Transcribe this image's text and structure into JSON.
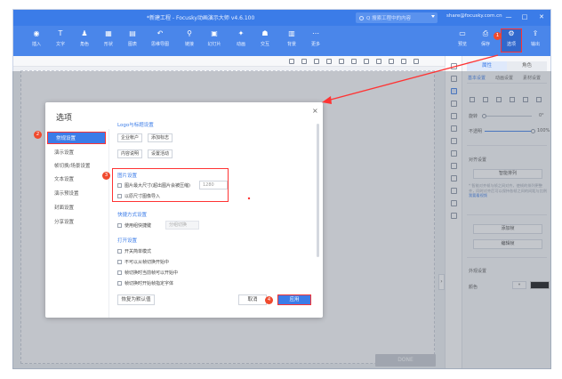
{
  "window": {
    "title": "*新建工程 - Focusky动画演示大师  v4.6.100",
    "search_placeholder": "Q  搜索工程中的内容",
    "user": "share@focusky.com.cn",
    "controls": [
      "—",
      "□",
      "✕"
    ]
  },
  "toolbar": {
    "left_tools": [
      {
        "icon": "◉",
        "label": "插入"
      },
      {
        "icon": "T",
        "label": "文字"
      },
      {
        "icon": "♟",
        "label": "角色"
      },
      {
        "icon": "▦",
        "label": "形状"
      },
      {
        "icon": "▤",
        "label": "图表"
      },
      {
        "icon": "↶",
        "label": "思维导图"
      },
      {
        "icon": "⚲",
        "label": "链接"
      },
      {
        "icon": "▣",
        "label": "幻灯片"
      },
      {
        "icon": "✦",
        "label": "动画"
      },
      {
        "icon": "☗",
        "label": "交互"
      },
      {
        "icon": "▥",
        "label": "背景"
      },
      {
        "icon": "⋯",
        "label": "更多"
      }
    ],
    "right_tools": [
      {
        "icon": "▭",
        "label": "预览"
      },
      {
        "icon": "⎙",
        "label": "保存"
      },
      {
        "icon": "⚙",
        "label": "选项"
      },
      {
        "icon": "⇪",
        "label": "输出"
      }
    ],
    "options_badge": "1"
  },
  "workspace": {
    "done_button": "DONE",
    "expand_handle": "›"
  },
  "panel": {
    "tabs": [
      "属性",
      "角色"
    ],
    "subtabs": [
      "基本设置",
      "动画设置",
      "素材设置"
    ],
    "angle_label": "旋转",
    "angle_value": "0°",
    "opacity_label": "不透明",
    "opacity_value": "100%",
    "layout_section": "对齐设置",
    "smart_align_button": "智能排列",
    "note_text": "* 智能对齐帧与帧之间对齐，使帧的排列更整齐，同时对齐后可以保持各帧之间的间距与比例",
    "note_link": "我要看视频",
    "add_frame_button": "添加帧",
    "edit_frame_button": "编辑帧",
    "appearance_section": "外观设置",
    "color_label": "颜色",
    "color_select": "▾",
    "color_value": "#111111"
  },
  "dialog": {
    "title": "选项",
    "close": "×",
    "badge_side": "2",
    "badge_section": "3",
    "badge_apply": "4",
    "sidebar": [
      {
        "label": "常规设置",
        "active": true
      },
      {
        "label": "演示设置",
        "active": false
      },
      {
        "label": "帧切换/场景设置",
        "active": false
      },
      {
        "label": "文本设置",
        "active": false
      },
      {
        "label": "演示预设置",
        "active": false
      },
      {
        "label": "封面设置",
        "active": false
      },
      {
        "label": "分享设置",
        "active": false
      }
    ],
    "logo_section": {
      "title": "Logo与标题设置",
      "buttons": [
        "企业帐户",
        "添加标志",
        "内容说明",
        "设置活动"
      ]
    },
    "image_section": {
      "title": "图片设置",
      "option1": "图片最大尺寸(超出图片会被压缩)",
      "option1_value": "1280",
      "option2": "以原尺寸图像导入"
    },
    "hotkey_section": {
      "title": "快捷方式设置",
      "option": "使用组快捷键",
      "input_value": "分组切换"
    },
    "open_section": {
      "title": "打开设置",
      "options": [
        "开关简单模式",
        "不可以从帧切换开始中",
        "帧切换时当前帧可以开始中",
        "帧切换时开始帧指定字体"
      ]
    },
    "footer": {
      "restore": "恢复为默认值",
      "cancel": "取消",
      "apply": "应用"
    }
  }
}
